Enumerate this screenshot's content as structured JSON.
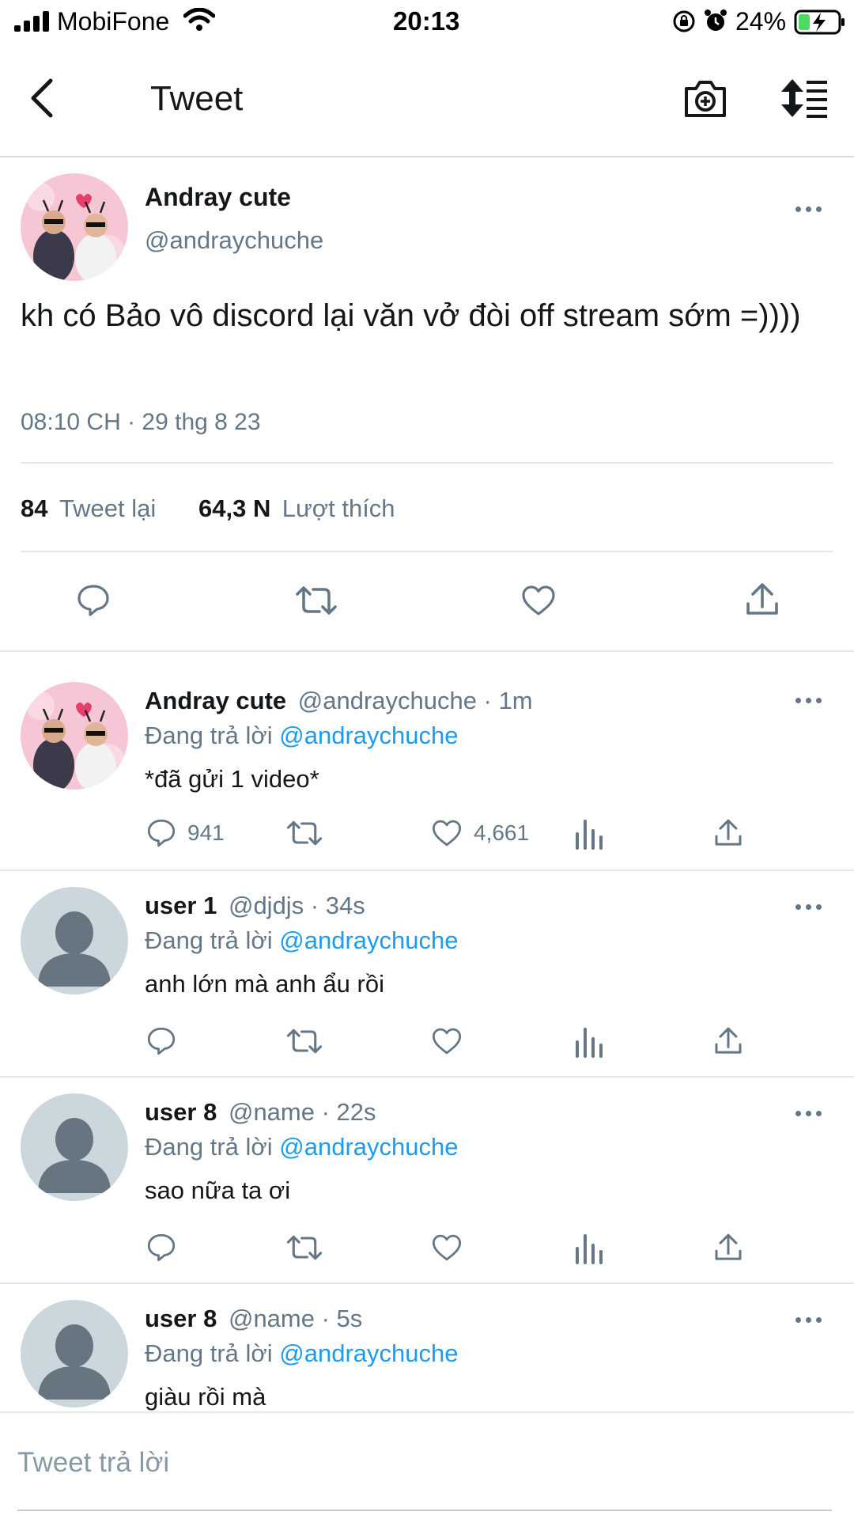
{
  "status_bar": {
    "carrier": "MobiFone",
    "time": "20:13",
    "battery": "24%"
  },
  "nav": {
    "title": "Tweet",
    "back_icon": "chevron-left-icon",
    "camera_icon": "camera-plus-icon",
    "sort_icon": "sort-list-icon"
  },
  "main_tweet": {
    "name": "Andray cute",
    "handle": "@andraychuche",
    "text": "kh có Bảo vô discord lại văn vở đòi off stream sớm =))))",
    "timestamp": "08:10 CH · 29 thg 8 23",
    "retweet_count": "84",
    "retweet_label": "Tweet lại",
    "like_count": "64,3 N",
    "like_label": "Lượt thích"
  },
  "replies": [
    {
      "name": "Andray cute",
      "handle_time": "@andraychuche · 1m",
      "replying_prefix": "Đang trả lời",
      "replying_to": "@andraychuche",
      "text": "*đã gửi 1 video*",
      "reply_count": "941",
      "like_count": "4,661"
    },
    {
      "name": "user 1",
      "handle_time": "@djdjs · 34s",
      "replying_prefix": "Đang trả lời",
      "replying_to": "@andraychuche",
      "text": "anh lớn mà anh ẩu rồi"
    },
    {
      "name": "user 8",
      "handle_time": "@name · 22s",
      "replying_prefix": "Đang trả lời",
      "replying_to": "@andraychuche",
      "text": "sao nữa ta ơi"
    },
    {
      "name": "user 8",
      "handle_time": "@name · 5s",
      "replying_prefix": "Đang trả lời",
      "replying_to": "@andraychuche",
      "text": "giàu rồi mà"
    }
  ],
  "compose": {
    "placeholder": "Tweet trả lời"
  },
  "colors": {
    "accent": "#1d9bf0",
    "secondary_text": "#657786",
    "battery_green": "#4cd964"
  }
}
